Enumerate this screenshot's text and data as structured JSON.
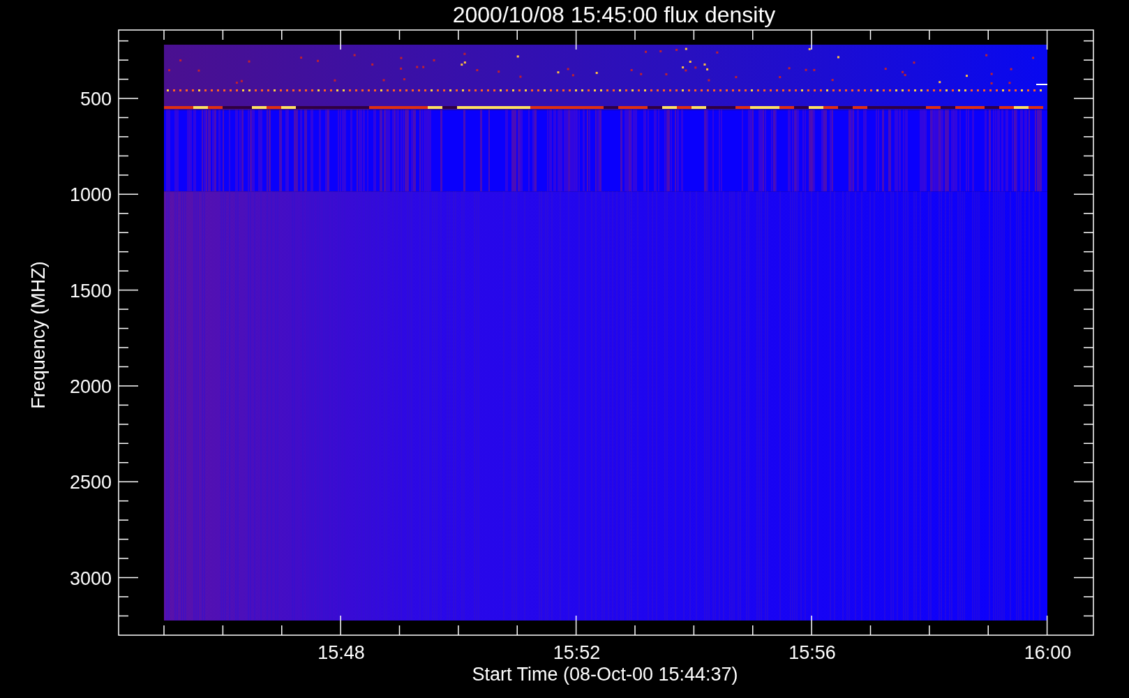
{
  "plot": {
    "title": "2000/10/08 15:45:00 flux density",
    "xlabel": "Start Time (08-Oct-00 15:44:37)",
    "ylabel": "Frequency (MHZ)",
    "x_tick_labels": [
      "15:48",
      "15:52",
      "15:56",
      "16:00"
    ],
    "y_tick_labels": [
      "500",
      "1000",
      "1500",
      "2000",
      "2500",
      "3000"
    ]
  }
}
